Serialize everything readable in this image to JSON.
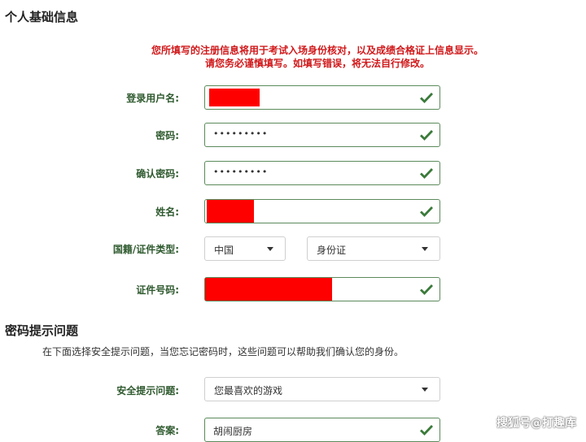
{
  "personal": {
    "title": "个人基础信息",
    "notice_line1": "您所填写的注册信息将用于考试入场身份核对，以及成绩合格证上信息显示。",
    "notice_line2": "请您务必谨慎填写。如填写错误，将无法自行修改。",
    "username_label": "登录用户名:",
    "password_label": "密码:",
    "password_value": "•••••••••",
    "confirm_label": "确认密码:",
    "confirm_value": "•••••••••",
    "name_label": "姓名:",
    "nationality_label": "国籍/证件类型:",
    "nationality_value": "中国",
    "id_type_value": "身份证",
    "id_number_label": "证件号码:"
  },
  "password_hint": {
    "title": "密码提示问题",
    "description": "在下面选择安全提示问题，当您忘记密码时，这些问题可以帮助我们确认您的身份。",
    "question_label": "安全提示问题:",
    "question_value": "您最喜欢的游戏",
    "answer_label": "答案:",
    "answer_value": "胡闹厨房"
  },
  "watermark": "搜狐号@打趣库",
  "colors": {
    "accent": "#5b8a5b",
    "warning": "#d0191b",
    "mask": "#ff0000",
    "check": "#3a7a3a"
  },
  "icons": {
    "valid": "check-icon",
    "dropdown": "caret-down-icon"
  }
}
